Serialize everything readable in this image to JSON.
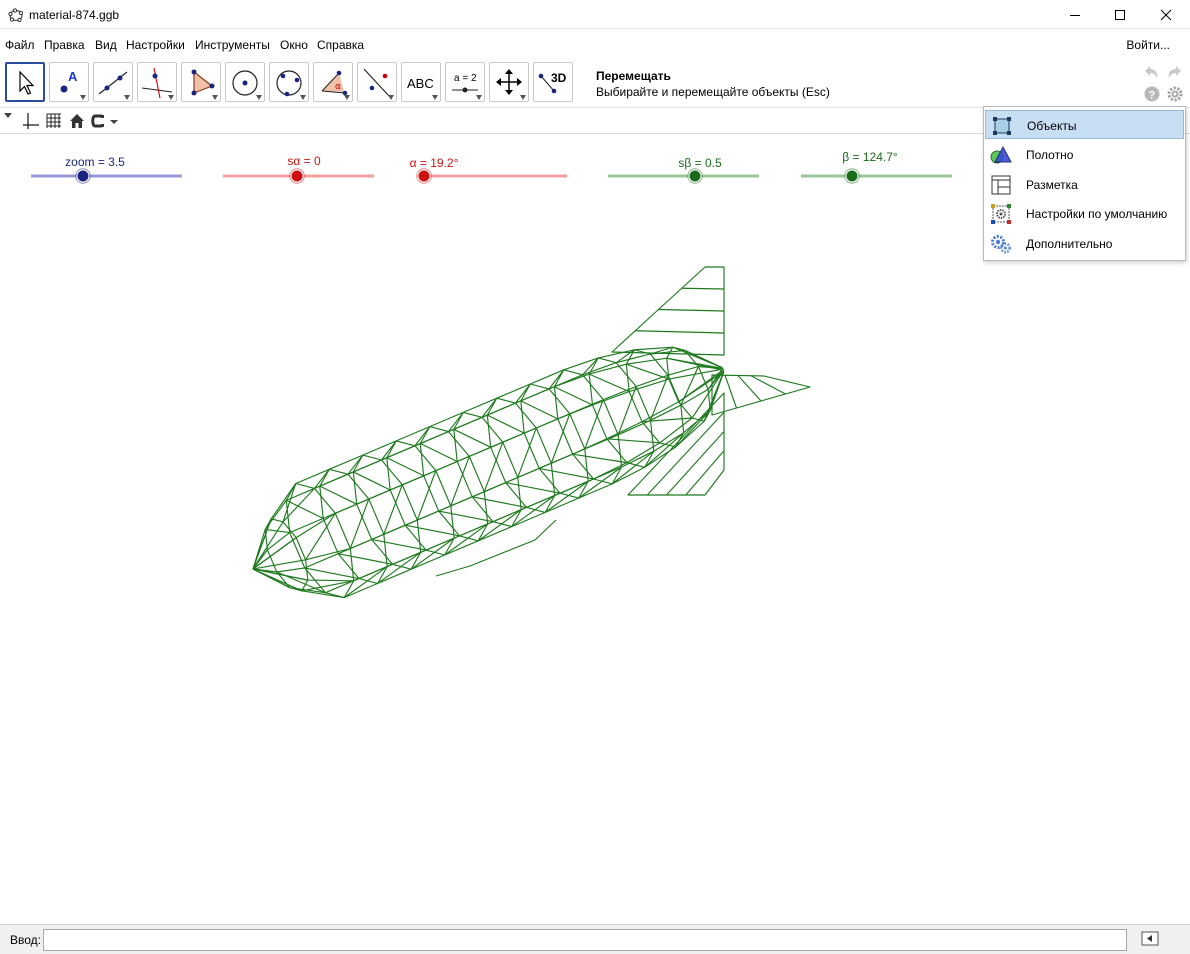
{
  "window": {
    "title": "material-874.ggb"
  },
  "menubar": {
    "items": [
      "Файл",
      "Правка",
      "Вид",
      "Настройки",
      "Инструменты",
      "Окно",
      "Справка"
    ],
    "signin": "Войти..."
  },
  "toolbar": {
    "tools": [
      "move-tool",
      "point-tool",
      "line-tool",
      "perpendicular-tool",
      "polygon-tool",
      "circle-tool",
      "circle-through-points-tool",
      "angle-tool",
      "reflect-tool",
      "text-tool",
      "slider-tool",
      "move-view-tool",
      "view-3d-tool"
    ],
    "text_tool_label": "ABC",
    "slider_tool_label": "a = 2",
    "view3d_label": "3D",
    "selected_tool_name": "Перемещать",
    "selected_tool_help": "Выбирайте и перемещайте объекты (Esc)"
  },
  "sliders": [
    {
      "name": "zoom",
      "label": "zoom = 3.5",
      "color": "#1a237e",
      "track": "#9898d8"
    },
    {
      "name": "s-alpha",
      "label": "sα = 0",
      "color": "#d01010",
      "track": "#f4a0a0"
    },
    {
      "name": "alpha",
      "label": "α = 19.2°",
      "color": "#d01010",
      "track": "#f4a0a0"
    },
    {
      "name": "s-beta",
      "label": "sβ = 0.5",
      "color": "#1a6b1a",
      "track": "#98c898"
    },
    {
      "name": "beta",
      "label": "β = 124.7°",
      "color": "#1a6b1a",
      "track": "#98c898"
    }
  ],
  "settings_menu": {
    "items": [
      "Объекты",
      "Полотно",
      "Разметка",
      "Настройки по умолчанию",
      "Дополнительно"
    ],
    "highlighted": "Объекты"
  },
  "input_bar": {
    "label": "Ввод:",
    "value": ""
  },
  "colors": {
    "wireframe": "#1f7a1f",
    "accent": "#2c4c9c"
  }
}
